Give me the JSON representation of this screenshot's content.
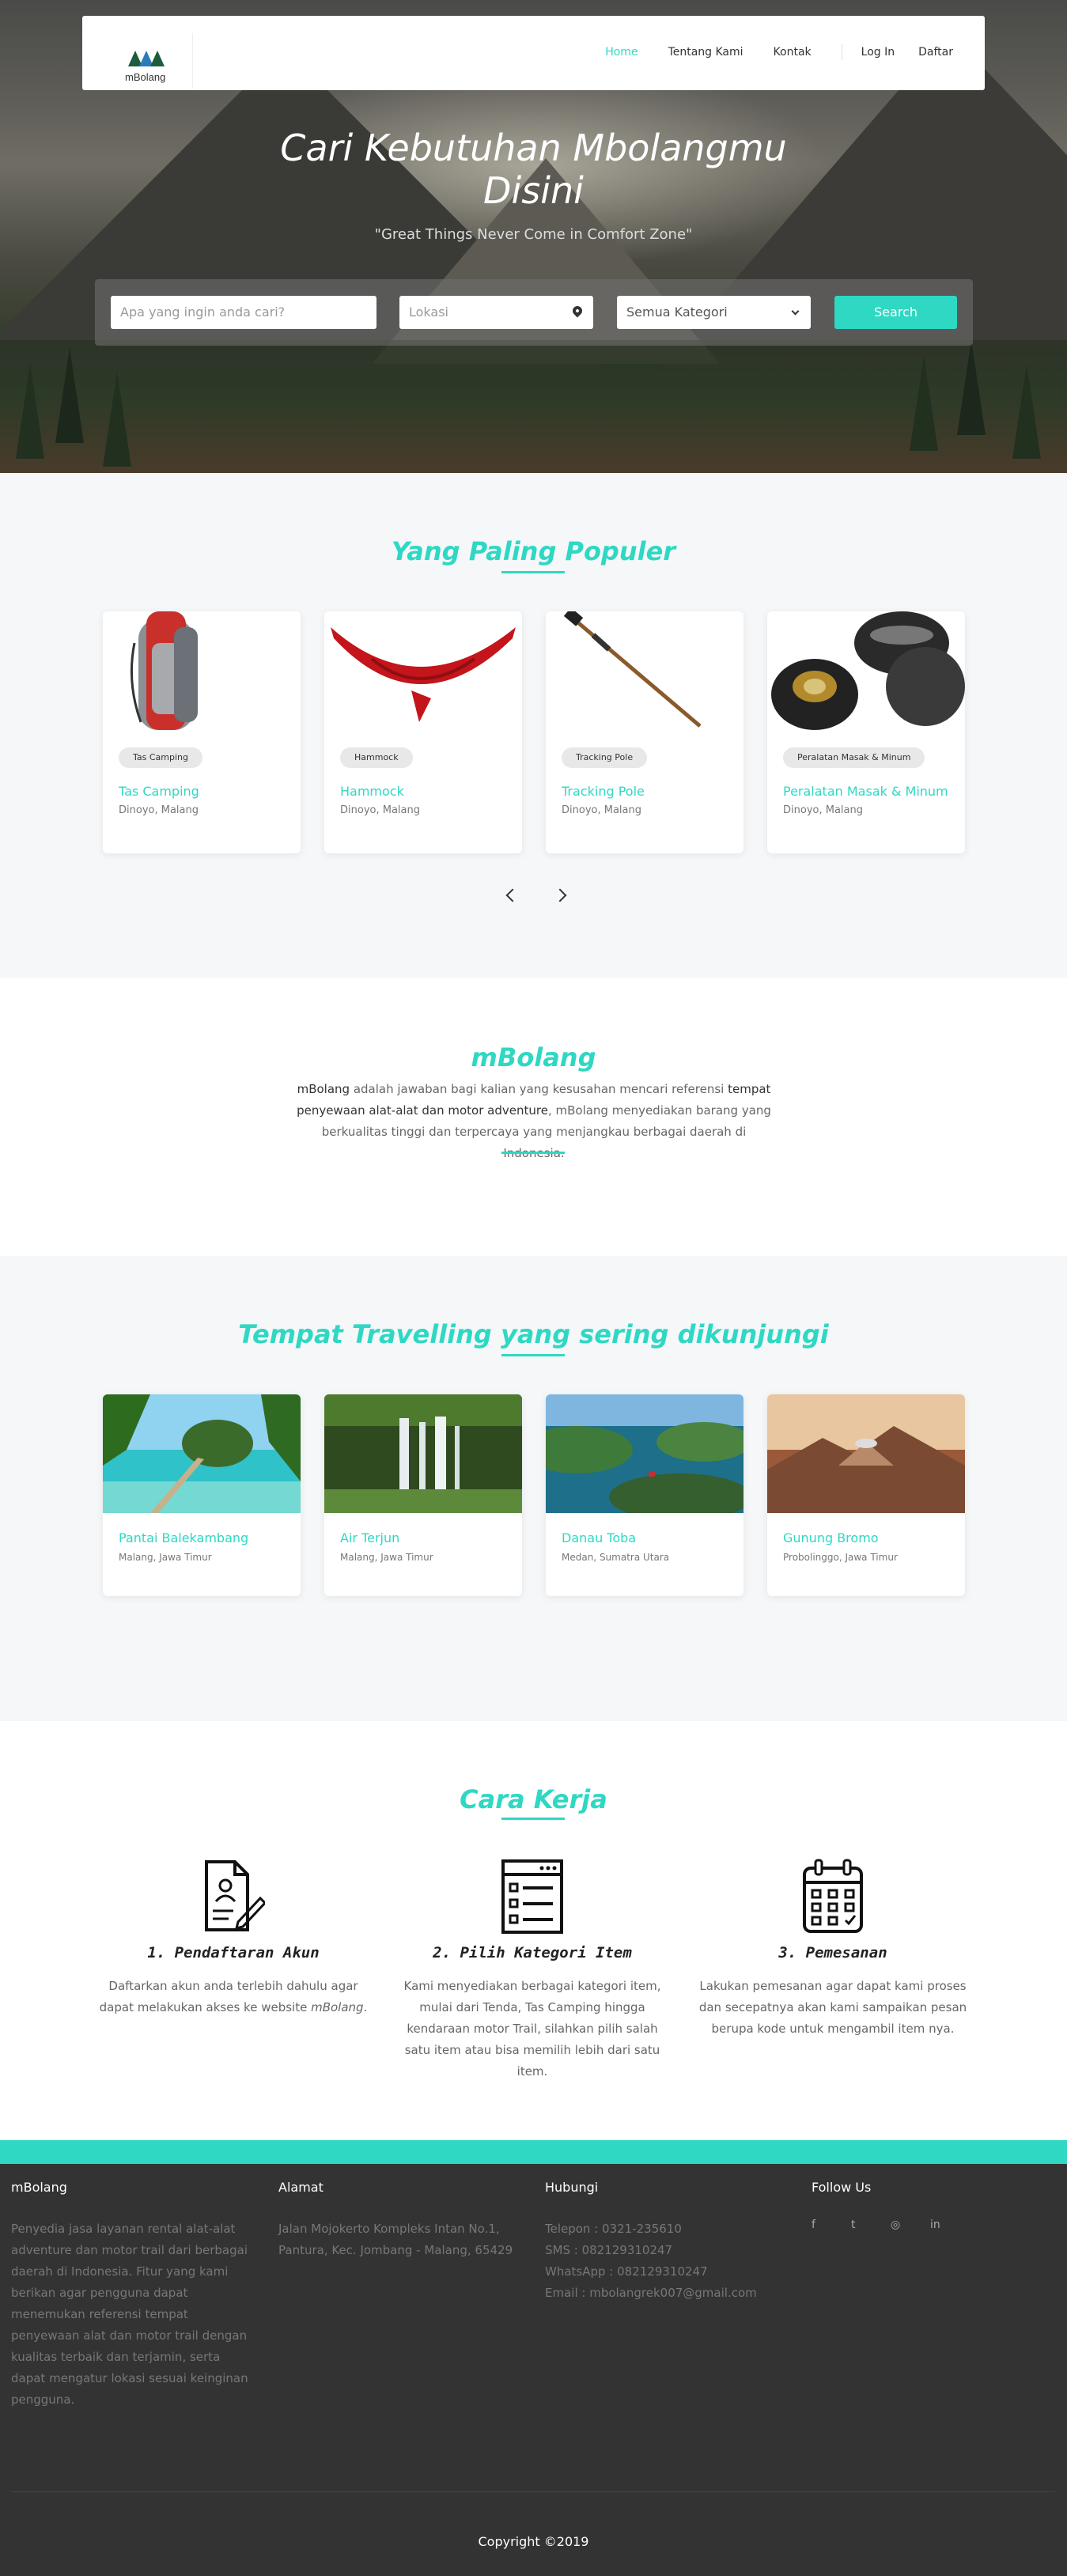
{
  "brand": {
    "name": "mBolang"
  },
  "nav": {
    "home": "Home",
    "about": "Tentang Kami",
    "contact": "Kontak",
    "login": "Log In",
    "register": "Daftar"
  },
  "hero": {
    "title_line1": "Cari Kebutuhan Mbolangmu",
    "title_line2": "Disini",
    "subtitle": "\"Great Things Never Come in Comfort Zone\""
  },
  "search": {
    "query_placeholder": "Apa yang ingin anda cari?",
    "location_placeholder": "Lokasi",
    "category_selected": "Semua Kategori",
    "button": "Search"
  },
  "popular": {
    "title": "Yang Paling Populer",
    "items": [
      {
        "badge": "Tas Camping",
        "name": "Tas Camping",
        "location": "Dinoyo, Malang"
      },
      {
        "badge": "Hammock",
        "name": "Hammock",
        "location": "Dinoyo, Malang"
      },
      {
        "badge": "Tracking Pole",
        "name": "Tracking Pole",
        "location": "Dinoyo, Malang"
      },
      {
        "badge": "Peralatan Masak & Minum",
        "name": "Peralatan Masak & Minum",
        "location": "Dinoyo, Malang"
      }
    ]
  },
  "about": {
    "title": "mBolang",
    "p1": "mBolang",
    "p2": " adalah jawaban bagi kalian yang kesusahan mencari referensi ",
    "p3": "tempat penyewaan alat-alat dan motor adventure",
    "p4": ", mBolang menyediakan barang yang berkualitas tinggi dan terpercaya yang menjangkau berbagai daerah di Indonesia."
  },
  "travel": {
    "title": "Tempat Travelling yang sering dikunjungi",
    "items": [
      {
        "name": "Pantai Balekambang",
        "location": "Malang, Jawa Timur"
      },
      {
        "name": "Air Terjun",
        "location": "Malang, Jawa Timur"
      },
      {
        "name": "Danau Toba",
        "location": "Medan, Sumatra Utara"
      },
      {
        "name": "Gunung Bromo",
        "location": "Probolinggo, Jawa Timur"
      }
    ]
  },
  "how": {
    "title": "Cara Kerja",
    "steps": [
      {
        "title": "1. Pendaftaran Akun",
        "text_a": "Daftarkan akun anda terlebih dahulu agar dapat melakukan akses ke website ",
        "text_b": "mBolang",
        "text_c": "."
      },
      {
        "title": "2. Pilih Kategori Item",
        "text": "Kami menyediakan berbagai kategori item, mulai dari Tenda, Tas Camping hingga kendaraan motor Trail, silahkan pilih salah satu item atau bisa memilih lebih dari satu item."
      },
      {
        "title": "3. Pemesanan",
        "text": "Lakukan pemesanan agar dapat kami proses dan secepatnya akan kami sampaikan pesan berupa kode untuk mengambil item nya."
      }
    ]
  },
  "footer": {
    "col1_title": "mBolang",
    "col1_text": "Penyedia jasa layanan rental alat-alat adventure dan motor trail dari berbagai daerah di Indonesia. Fitur yang kami berikan agar pengguna dapat menemukan referensi tempat penyewaan alat dan motor trail dengan kualitas terbaik dan terjamin, serta dapat mengatur lokasi sesuai keinginan pengguna.",
    "col2_title": "Alamat",
    "col2_text": "Jalan Mojokerto Kompleks Intan No.1, Pantura, Kec. Jombang - Malang, 65429",
    "col3_title": "Hubungi",
    "phone": "Telepon : 0321-235610",
    "sms": "SMS : 082129310247",
    "whatsapp": "WhatsApp : 082129310247",
    "email": "Email : mbolangrek007@gmail.com",
    "col4_title": "Follow Us",
    "social": [
      "f",
      "t",
      "◎",
      "in"
    ],
    "copyright": "Copyright ©2019"
  },
  "colors": {
    "accent": "#2ed8c3",
    "footer": "#333333",
    "section_bg": "#f5f7f9"
  },
  "icons": [
    "location-pin-icon",
    "chevron-down-icon",
    "chevron-left-icon",
    "chevron-right-icon",
    "document-edit-icon",
    "list-window-icon",
    "calendar-icon",
    "facebook-icon",
    "twitter-icon",
    "instagram-icon",
    "linkedin-icon"
  ]
}
